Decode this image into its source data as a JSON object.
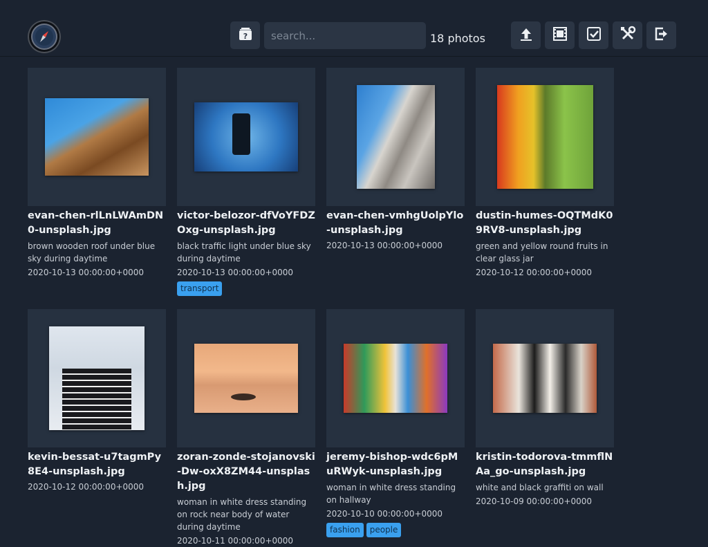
{
  "header": {
    "search_placeholder": "search...",
    "photo_count": "18 photos",
    "icons": [
      "logo-icon",
      "random-photo-icon",
      "upload-icon",
      "slideshow-icon",
      "select-icon",
      "settings-icon",
      "logout-icon"
    ]
  },
  "photos": [
    {
      "filename": "evan-chen-rlLnLWAmDN0-unsplash.jpg",
      "description": "brown wooden roof under blue sky during daytime",
      "date": "2020-10-13 00:00:00+0000",
      "tags": []
    },
    {
      "filename": "victor-belozor-dfVoYFDZOxg-unsplash.jpg",
      "description": "black traffic light under blue sky during daytime",
      "date": "2020-10-13 00:00:00+0000",
      "tags": [
        "transport"
      ]
    },
    {
      "filename": "evan-chen-vmhgUolpYlo-unsplash.jpg",
      "description": "",
      "date": "2020-10-13 00:00:00+0000",
      "tags": []
    },
    {
      "filename": "dustin-humes-OQTMdK09RV8-unsplash.jpg",
      "description": "green and yellow round fruits in clear glass jar",
      "date": "2020-10-12 00:00:00+0000",
      "tags": []
    },
    {
      "filename": "kevin-bessat-u7tagmPy8E4-unsplash.jpg",
      "description": "",
      "date": "2020-10-12 00:00:00+0000",
      "tags": []
    },
    {
      "filename": "zoran-zonde-stojanovski-Dw-oxX8ZM44-unsplash.jpg",
      "description": "woman in white dress standing on rock near body of water during daytime",
      "date": "2020-10-11 00:00:00+0000",
      "tags": []
    },
    {
      "filename": "jeremy-bishop-wdc6pMuRWyk-unsplash.jpg",
      "description": "woman in white dress standing on hallway",
      "date": "2020-10-10 00:00:00+0000",
      "tags": [
        "fashion",
        "people"
      ]
    },
    {
      "filename": "kristin-todorova-tmmflNAa_go-unsplash.jpg",
      "description": "white and black graffiti on wall",
      "date": "2020-10-09 00:00:00+0000",
      "tags": []
    }
  ],
  "colors": {
    "background": "#1b2330",
    "button": "#2b3544",
    "tile": "#263140",
    "tag": "#3aa0ef"
  }
}
